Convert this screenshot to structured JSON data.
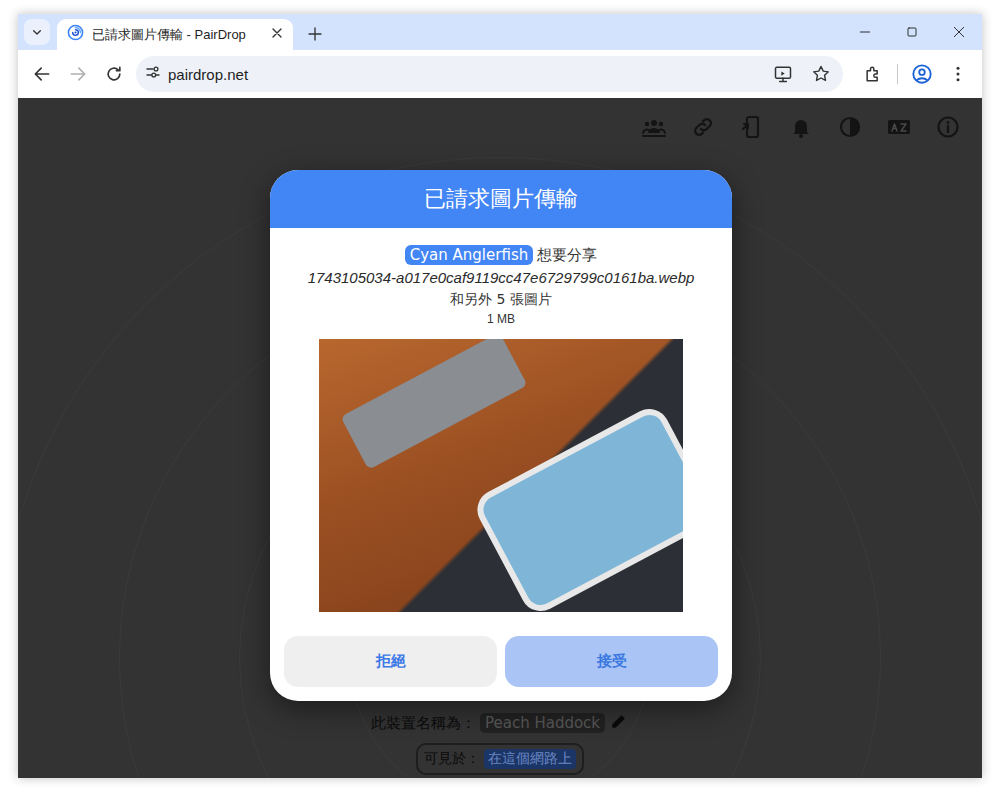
{
  "window": {
    "title": "已請求圖片傳輸 - PairDrop"
  },
  "tabs": [
    {
      "label": "已請求圖片傳輸 - PairDrop",
      "selected": true
    }
  ],
  "address_bar": {
    "url": "pairdrop.net"
  },
  "nav": {
    "back_enabled": true,
    "forward_enabled": false
  },
  "dialog": {
    "title": "已請求圖片傳輸",
    "sender": "Cyan Anglerfish",
    "action": "想要分享",
    "file_name": "1743105034-a017e0caf9119cc47e6729799c0161ba.webp",
    "more": "和另外 5 張圖片",
    "size": "1 MB",
    "buttons": [
      {
        "label": "拒絕",
        "kind": "secondary"
      },
      {
        "label": "接受",
        "kind": "primary"
      }
    ]
  },
  "footer": {
    "device_label": "此裝置名稱為：",
    "device_name": "Peach Haddock",
    "visible_label": "可見於：",
    "visibility": "在這個網路上"
  }
}
